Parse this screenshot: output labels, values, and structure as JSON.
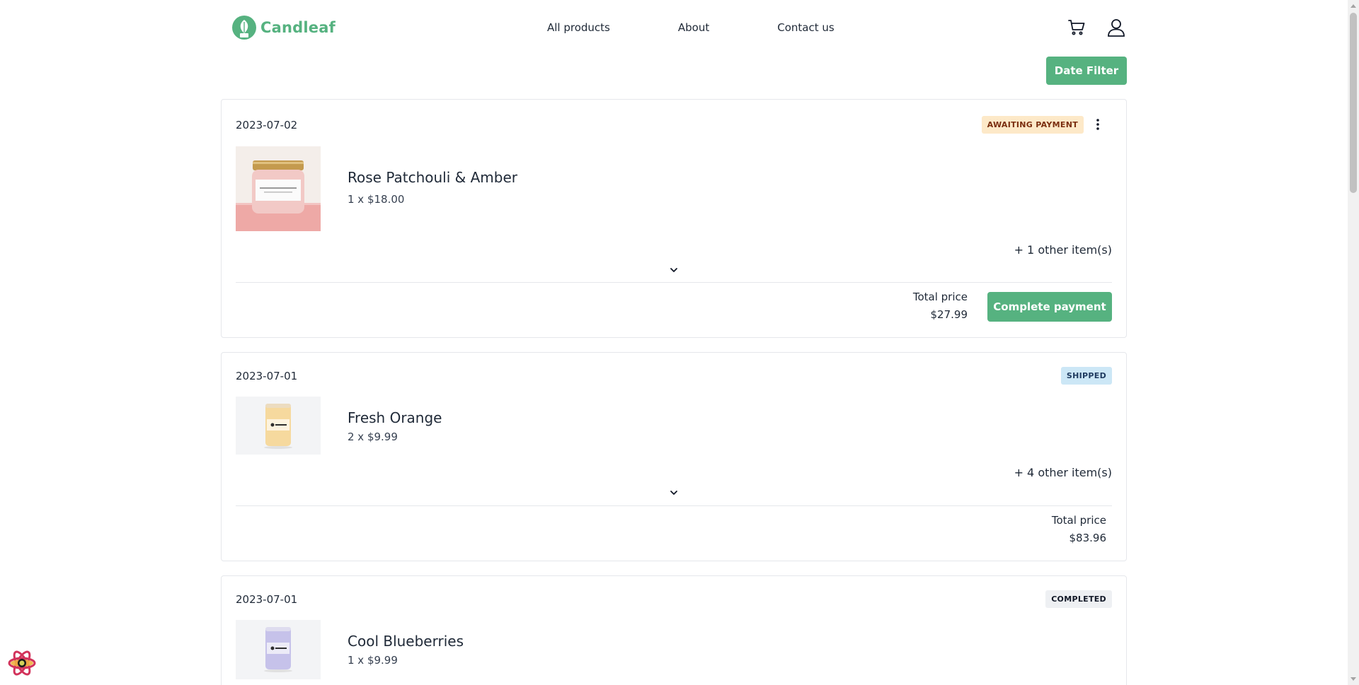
{
  "brand": {
    "name": "Candleaf",
    "accent": "#56b280"
  },
  "nav": {
    "items": [
      "All products",
      "About",
      "Contact us"
    ]
  },
  "header_icons": [
    "cart-icon",
    "user-icon"
  ],
  "date_filter": {
    "label": "Date Filter"
  },
  "orders": [
    {
      "date": "2023-07-02",
      "status": "Awaiting payment",
      "status_color": "#fde9c8",
      "product": {
        "name": "Rose Patchouli & Amber",
        "qty": "1 x $18.00"
      },
      "more": "+ 1 other item(s)",
      "total_label": "Total price",
      "total_value": "$27.99",
      "action": "Complete payment"
    },
    {
      "date": "2023-07-01",
      "status": "Shipped",
      "status_color": "#cce7f6",
      "product": {
        "name": "Fresh Orange",
        "qty": "2 x $9.99"
      },
      "more": "+ 4 other item(s)",
      "total_label": "Total price",
      "total_value": "$83.96"
    },
    {
      "date": "2023-07-01",
      "status": "Completed",
      "status_color": "#eef0f3",
      "product": {
        "name": "Cool Blueberries",
        "qty": "1 x $9.99"
      }
    }
  ]
}
